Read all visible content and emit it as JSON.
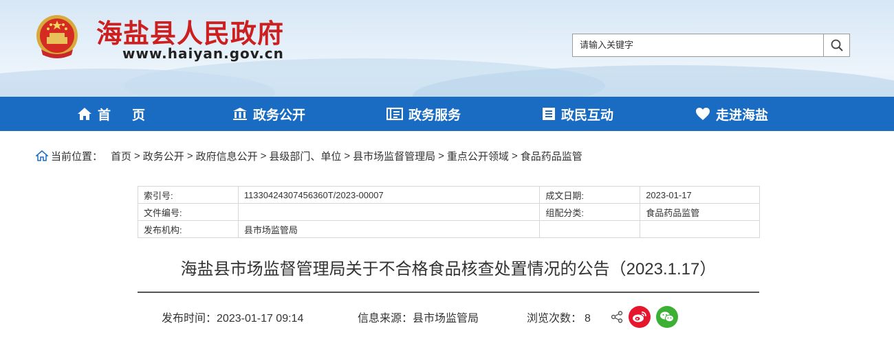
{
  "header": {
    "site_title": "海盐县人民政府",
    "site_url": "www.haiyan.gov.cn",
    "search_placeholder": "请输入关键字",
    "brand_red": "#cc1f1f"
  },
  "nav": {
    "bg_color": "#1a6cc3",
    "items": [
      {
        "label": "首　页",
        "icon": "home-icon"
      },
      {
        "label": "政务公开",
        "icon": "building-icon"
      },
      {
        "label": "政务服务",
        "icon": "service-book-icon"
      },
      {
        "label": "政民互动",
        "icon": "list-doc-icon"
      },
      {
        "label": "走进海盐",
        "icon": "heart-icon"
      }
    ]
  },
  "breadcrumb": {
    "label": "当前位置：",
    "items": [
      "首页",
      "政务公开",
      "政府信息公开",
      "县级部门、单位",
      "县市场监督管理局",
      "重点公开领域",
      "食品药品监管"
    ],
    "separator": ">"
  },
  "info": {
    "index_label": "索引号:",
    "index_value": "11330424307456360T/2023-00007",
    "date_label": "成文日期:",
    "date_value": "2023-01-17",
    "doc_no_label": "文件编号:",
    "doc_no_value": "",
    "category_label": "组配分类:",
    "category_value": "食品药品监管",
    "issuer_label": "发布机构:",
    "issuer_value": "县市场监管局"
  },
  "article": {
    "title": "海盐县市场监督管理局关于不合格食品核查处置情况的公告（2023.1.17）",
    "publish_label": "发布时间：",
    "publish_time": "2023-01-17 09:14",
    "source_label": "信息来源：",
    "source_value": "县市场监管局",
    "views_label": "浏览次数：",
    "views_value": "8"
  },
  "share": {
    "weibo_color": "#e6162d",
    "wechat_color": "#3cb034"
  }
}
